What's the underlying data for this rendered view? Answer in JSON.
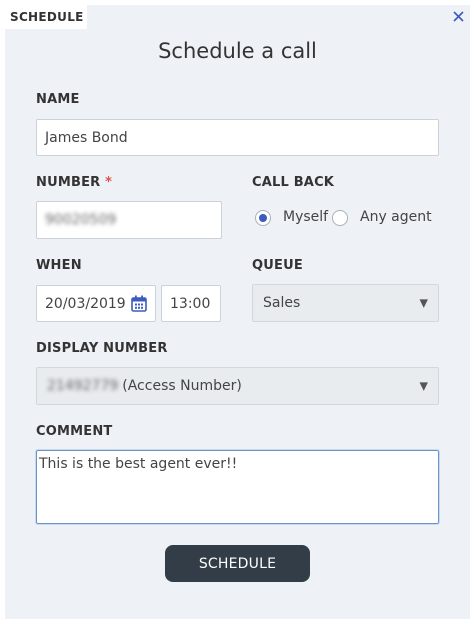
{
  "tab": {
    "label": "SCHEDULE"
  },
  "title": "Schedule a call",
  "name": {
    "label": "NAME",
    "value": "James Bond"
  },
  "number": {
    "label": "NUMBER",
    "required_mark": "*",
    "value": "90020509"
  },
  "callback": {
    "label": "CALL BACK",
    "options": [
      {
        "label": "Myself",
        "selected": true
      },
      {
        "label": "Any agent",
        "selected": false
      }
    ]
  },
  "when": {
    "label": "WHEN",
    "date": "20/03/2019",
    "time": "13:00"
  },
  "queue": {
    "label": "QUEUE",
    "selected": "Sales"
  },
  "display_number": {
    "label": "DISPLAY NUMBER",
    "number": "21492779",
    "suffix": "(Access Number)"
  },
  "comment": {
    "label": "COMMENT",
    "value": "This is the best agent ever!!"
  },
  "submit": {
    "label": "SCHEDULE"
  },
  "colors": {
    "accent": "#3b5bbf",
    "button": "#323d48",
    "panel": "#eef1f5",
    "required": "#e05050"
  },
  "icons": {
    "close": "close-icon",
    "calendar": "calendar-icon",
    "dropdown": "chevron-down-icon"
  }
}
